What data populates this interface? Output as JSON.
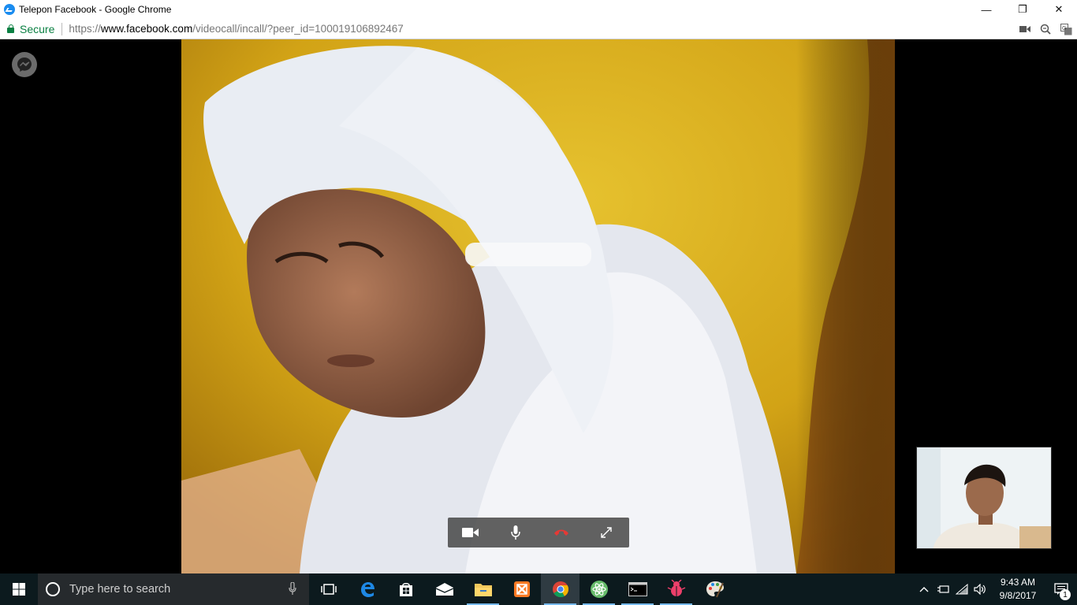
{
  "window": {
    "title": "Telepon Facebook - Google Chrome",
    "minimize": "—",
    "restore": "❐",
    "close": "✕"
  },
  "addressbar": {
    "secure_label": "Secure",
    "url_scheme": "https://",
    "url_host": "www.facebook.com",
    "url_path": "/videocall/incall/?peer_id=100019106892467"
  },
  "call": {
    "controls": [
      "camera",
      "microphone",
      "end-call",
      "fullscreen"
    ]
  },
  "taskbar": {
    "search_placeholder": "Type here to search",
    "apps": [
      "task-view",
      "edge",
      "store",
      "mail",
      "file-explorer",
      "xampp",
      "chrome",
      "atom",
      "cmd",
      "bug-app",
      "paint"
    ],
    "time": "9:43 AM",
    "date": "9/8/2017",
    "notification_count": "1"
  },
  "colors": {
    "secure_green": "#0b8043",
    "taskbar_bg": "#0c1a1e",
    "end_call_red": "#e53935"
  }
}
